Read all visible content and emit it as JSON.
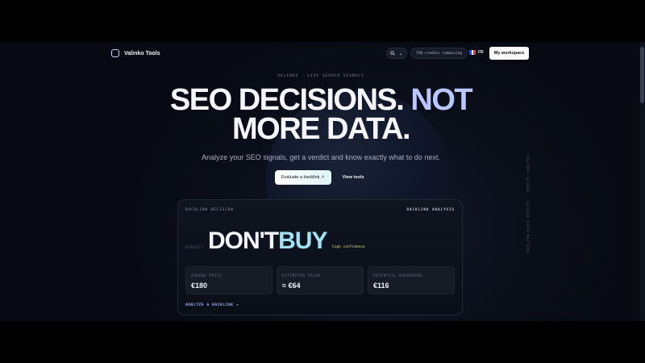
{
  "nav": {
    "brand_name": "Valinko Tools",
    "search_chevron": "⌄",
    "credits": "750 credits remaining",
    "language": "FR",
    "workspace_button": "My workspace"
  },
  "hero": {
    "eyebrow": "VALINKO · LIVE SEARCH SIGNALS",
    "headline_part1": "SEO DECISIONS.",
    "headline_accent": "NOT",
    "headline_line2": "MORE DATA.",
    "subhead": "Analyze your SEO signals, get a verdict and know exactly what to do next.",
    "cta_primary": "Evaluate a backlink ↗",
    "cta_secondary": "View tools"
  },
  "side_text": "VALINKO SIGNAL · SEARCH DATA MATTERS",
  "card": {
    "label_left": "BACKLINK DECISION",
    "label_right": "BACKLINK ANALYSIS",
    "verdict_label": "VERDICT",
    "verdict_part1": "DON'T",
    "verdict_part2": "BUY",
    "confidence": "high confidence",
    "stats": [
      {
        "label": "ASKING PRICE",
        "value": "€180"
      },
      {
        "label": "ESTIMATED VALUE",
        "value": "≈ €64"
      },
      {
        "label": "POTENTIAL OVERSPEND",
        "value": "€116"
      }
    ],
    "link": "ANALYZE A BACKLINK ↗"
  },
  "colors": {
    "background": "#0b0f1a",
    "accent": "#b9c6ff",
    "verdict_accent": "#9fe3f5",
    "confidence": "#d7e08a"
  },
  "icons": [
    "logo-mark-icon",
    "search-icon",
    "chevron-down-icon",
    "flag-fr-icon",
    "arrow-up-right-icon"
  ]
}
